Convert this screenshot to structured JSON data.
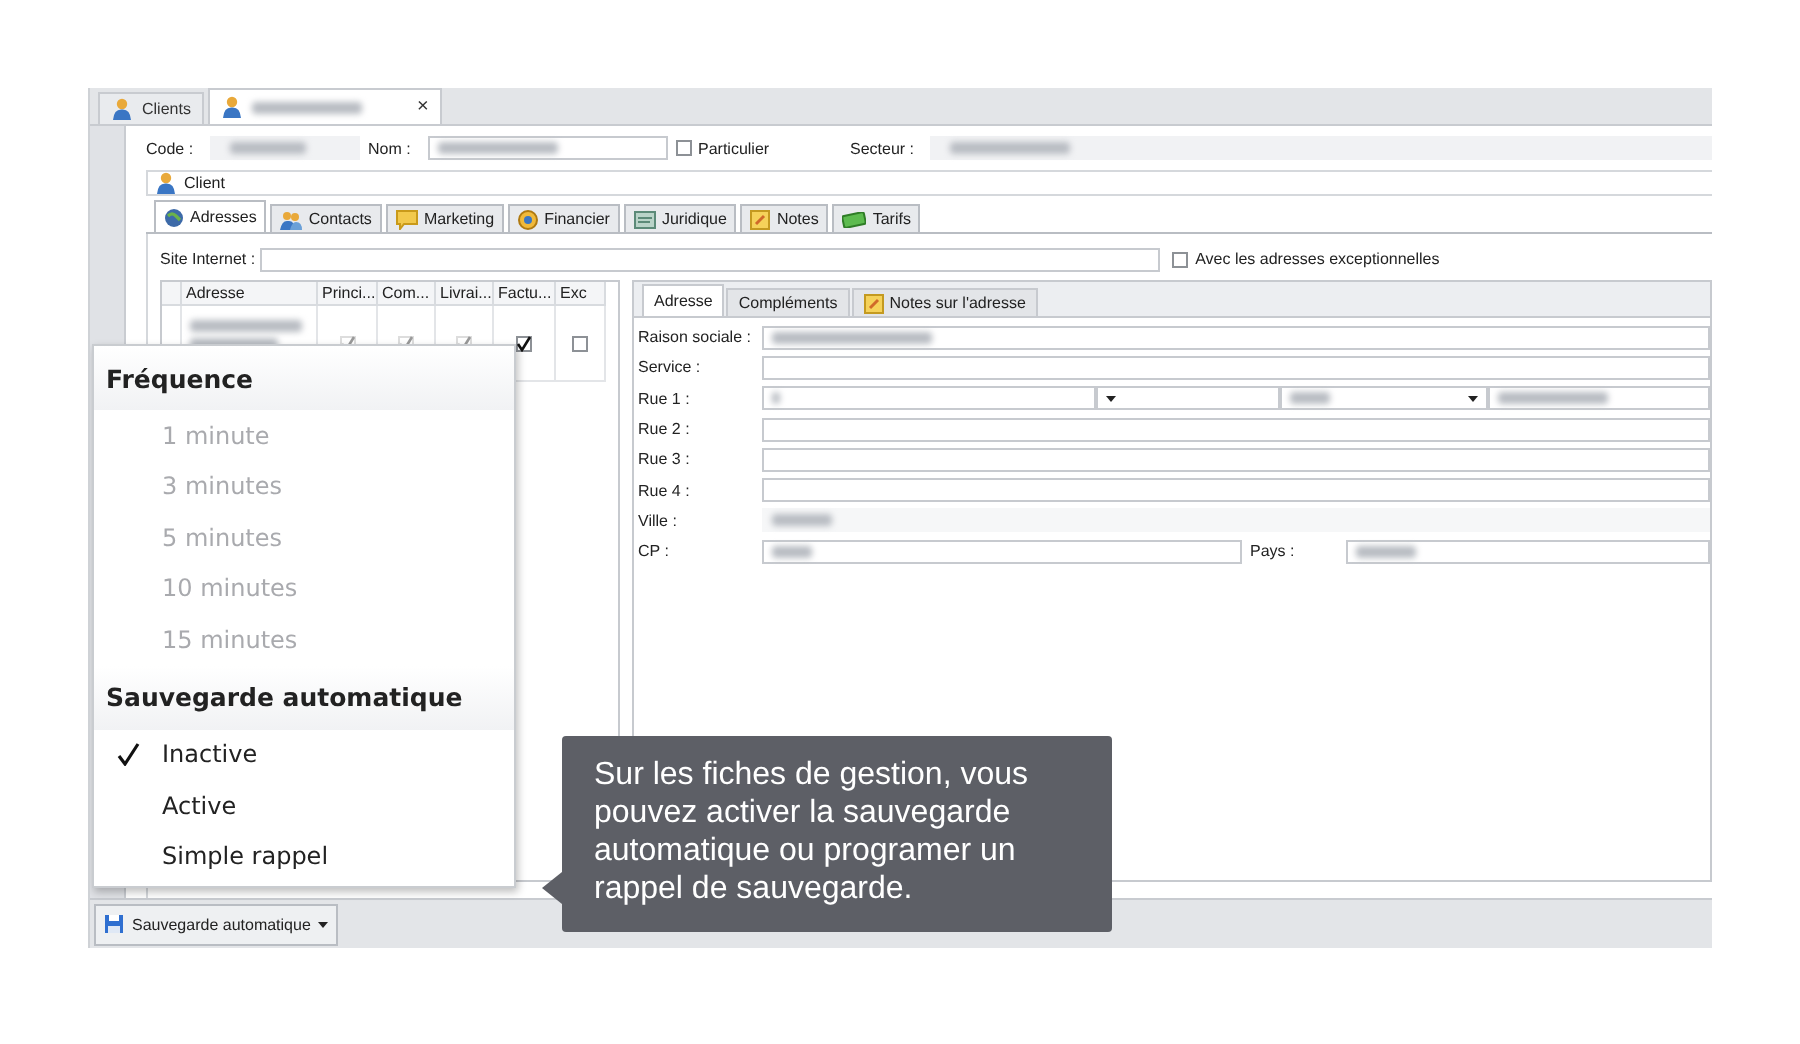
{
  "document_tabs": [
    {
      "label": "Clients",
      "selected": false,
      "closable": false
    },
    {
      "blurred": true,
      "selected": true,
      "closable": true,
      "close_glyph": "×"
    }
  ],
  "header_fields": [
    {
      "kind": "value",
      "label": "Code :",
      "blurred": true
    },
    {
      "kind": "input",
      "label": "Nom :",
      "blurred": true
    },
    {
      "kind": "checkbox",
      "label": "Particulier",
      "checked": false
    },
    {
      "kind": "value",
      "label": "Secteur :",
      "blurred": true
    }
  ],
  "section_title": "Client",
  "section_tabs": [
    {
      "label": "Adresses",
      "selected": true
    },
    {
      "label": "Contacts",
      "selected": false
    },
    {
      "label": "Marketing",
      "selected": false
    },
    {
      "label": "Financier",
      "selected": false
    },
    {
      "label": "Juridique",
      "selected": false
    },
    {
      "label": "Notes",
      "selected": false
    },
    {
      "label": "Tarifs",
      "selected": false
    }
  ],
  "site_internet": {
    "label": "Site Internet :"
  },
  "exceptional_addresses": {
    "label": "Avec les adresses exceptionnelles",
    "checked": false
  },
  "address_grid": {
    "columns": [
      "Adresse",
      "Princi...",
      "Com...",
      "Livrai...",
      "Factu...",
      "Exc"
    ],
    "rows": [
      {
        "blurred": true,
        "flags": [
          {
            "checked": true,
            "disabled": true
          },
          {
            "checked": true,
            "disabled": true
          },
          {
            "checked": true,
            "disabled": true
          },
          {
            "checked": true,
            "disabled": false
          },
          {
            "checked": false,
            "disabled": false
          }
        ]
      }
    ]
  },
  "detail_tabs": [
    {
      "label": "Adresse",
      "selected": true
    },
    {
      "label": "Compléments",
      "selected": false
    },
    {
      "label": "Notes sur l'adresse",
      "selected": false
    }
  ],
  "detail_fields": [
    {
      "kind": "text",
      "label": "Raison sociale :",
      "blurred": true
    },
    {
      "kind": "text",
      "label": "Service :",
      "blurred": false
    },
    {
      "kind": "street",
      "label": "Rue 1 :",
      "blurred": true
    },
    {
      "kind": "text",
      "label": "Rue 2 :",
      "blurred": false
    },
    {
      "kind": "text",
      "label": "Rue 3 :",
      "blurred": false
    },
    {
      "kind": "text",
      "label": "Rue 4 :",
      "blurred": false
    },
    {
      "kind": "plain",
      "label": "Ville :",
      "blurred": true
    },
    {
      "kind": "pair",
      "label": "CP :",
      "blurred": true,
      "second_label": "Pays :"
    }
  ],
  "autosave_button": {
    "label": "Sauvegarde automatique"
  },
  "menu": {
    "sections": [
      {
        "title": "Fréquence",
        "items": [
          {
            "label": "1 minute",
            "disabled": true,
            "checked": false
          },
          {
            "label": "3 minutes",
            "disabled": true,
            "checked": false
          },
          {
            "label": "5 minutes",
            "disabled": true,
            "checked": false
          },
          {
            "label": "10 minutes",
            "disabled": true,
            "checked": false
          },
          {
            "label": "15 minutes",
            "disabled": true,
            "checked": false
          }
        ]
      },
      {
        "title": "Sauvegarde automatique",
        "items": [
          {
            "label": "Inactive",
            "disabled": false,
            "checked": true
          },
          {
            "label": "Active",
            "disabled": false,
            "checked": false
          },
          {
            "label": "Simple rappel",
            "disabled": false,
            "checked": false
          }
        ]
      }
    ]
  },
  "tooltip": {
    "text": "Sur les fiches de gestion, vous pouvez activer la sauvegarde automatique ou programer un rappel de sauvegarde."
  }
}
